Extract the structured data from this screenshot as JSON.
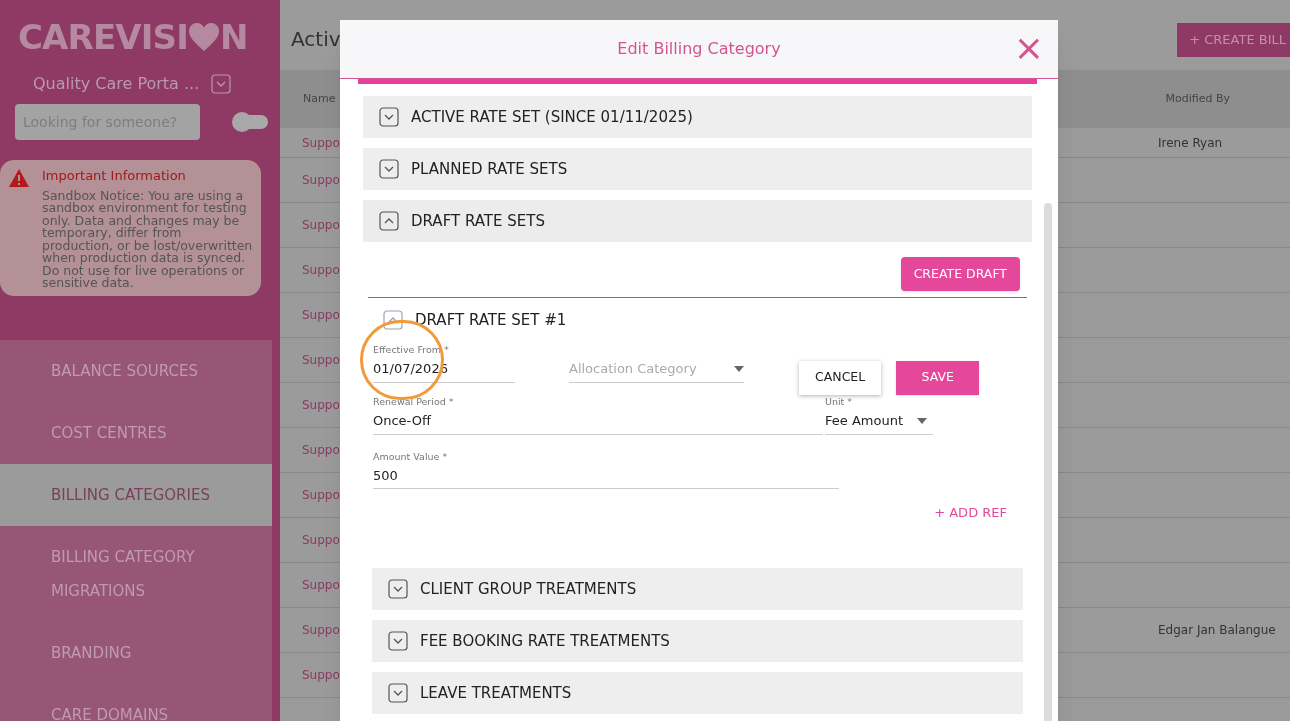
{
  "sidebar": {
    "logo": {
      "before": "CAREVISI",
      "after": "N"
    },
    "org": "Quality Care Porta ...",
    "search": {
      "placeholder": "Looking for someone?"
    },
    "toggle": {
      "on": false
    },
    "notice": {
      "title": "Important Information",
      "body": "Sandbox Notice: You are using a sandbox environment for testing only. Data and changes may be temporary, differ from production, or be lost/overwritten when production data is synced. Do not use for live operations or sensitive data."
    },
    "items": [
      {
        "label": "BALANCE SOURCES",
        "selected": false
      },
      {
        "label": "COST CENTRES",
        "selected": false
      },
      {
        "label": "BILLING CATEGORIES",
        "selected": true
      },
      {
        "label": "BILLING CATEGORY MIGRATIONS",
        "selected": false
      },
      {
        "label": "BRANDING",
        "selected": false
      },
      {
        "label": "CARE DOMAINS",
        "selected": false
      }
    ]
  },
  "page": {
    "title": "Activ",
    "create_button": "+ CREATE BILL",
    "table": {
      "columns": [
        "Name",
        "Modified By"
      ],
      "rows": [
        [
          "Suppo",
          "Irene Ryan"
        ],
        [
          "Suppo",
          ""
        ],
        [
          "Suppo",
          ""
        ],
        [
          "Suppo",
          ""
        ],
        [
          "Suppo",
          ""
        ],
        [
          "Suppo",
          ""
        ],
        [
          "Suppo",
          ""
        ],
        [
          "Suppo",
          ""
        ],
        [
          "Suppo",
          ""
        ],
        [
          "Suppo",
          ""
        ],
        [
          "Suppo",
          ""
        ],
        [
          "Suppo",
          "Edgar Jan Balangue"
        ],
        [
          "Suppo",
          ""
        ]
      ]
    }
  },
  "dialog": {
    "title": "Edit Billing Category",
    "close": "×",
    "sections": [
      {
        "label": "ACTIVE RATE SET (SINCE 01/11/2025)",
        "expanded": false
      },
      {
        "label": "PLANNED RATE SETS",
        "expanded": false
      },
      {
        "label": "DRAFT RATE SETS",
        "expanded": true
      }
    ],
    "create_draft": "CREATE DRAFT",
    "draft": {
      "label": "DRAFT RATE SET #1",
      "expanded": true,
      "effective_from": {
        "label": "Effective From *",
        "value": "01/07/2026"
      },
      "allocation": {
        "placeholder": "Allocation Category"
      },
      "cancel": "CANCEL",
      "save": "SAVE",
      "renewal": {
        "label": "Renewal Period *",
        "value": "Once-Off"
      },
      "unit": {
        "label": "Unit *",
        "value": "Fee Amount"
      },
      "amount": {
        "label": "Amount Value *",
        "value": "500"
      },
      "add_ref": "+ ADD REF"
    },
    "treatments": [
      {
        "label": "CLIENT GROUP TREATMENTS",
        "expanded": false
      },
      {
        "label": "FEE BOOKING RATE TREATMENTS",
        "expanded": false
      },
      {
        "label": "LEAVE TREATMENTS",
        "expanded": false
      }
    ]
  }
}
